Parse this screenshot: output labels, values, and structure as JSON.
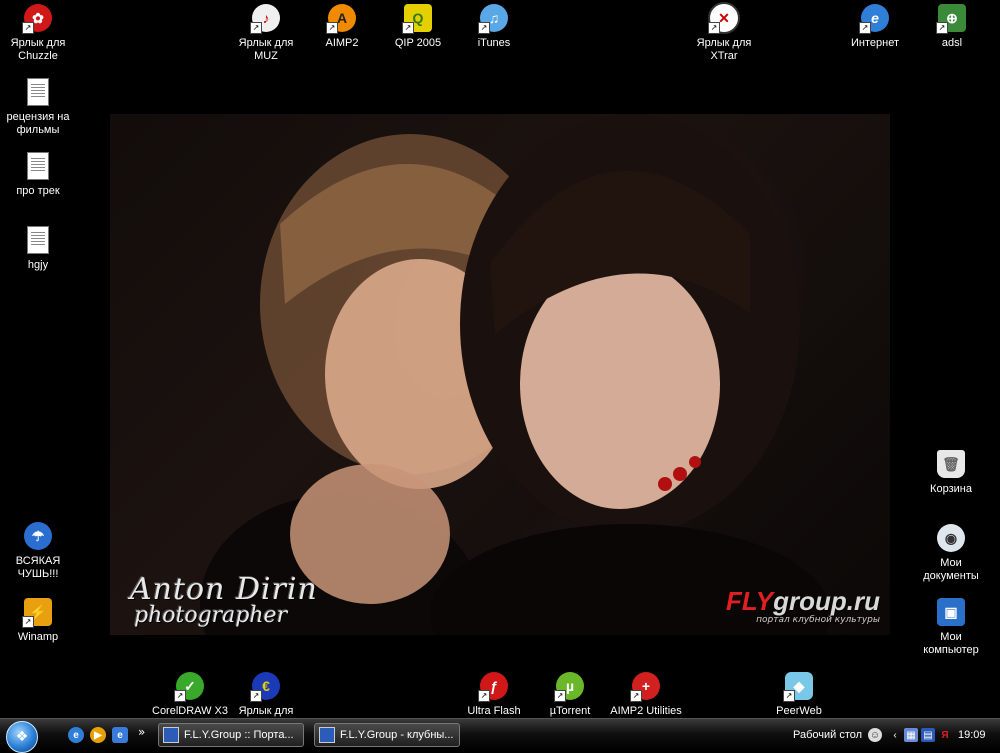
{
  "desktop": {
    "wallpaper": {
      "watermark_left_line1": "Anton Dirin",
      "watermark_left_line2": "photographer",
      "watermark_right_brand_accent": "FLY",
      "watermark_right_brand_rest": "group.ru",
      "watermark_right_tagline": "портал клубной культуры"
    },
    "icons": {
      "chuzzle": "Ярлык для Chuzzle",
      "muz": "Ярлык для MUZ",
      "aimp2": "AIMP2",
      "qip": "QIP 2005",
      "itunes": "iTunes",
      "xtrar": "Ярлык для XTrar",
      "internet": "Интернет",
      "adsl": "adsl",
      "recenzia": "рецензия на фильмы",
      "pro_trek": "про трек",
      "hgjy": "hgjy",
      "vsyakaya": "ВСЯКАЯ ЧУШЬ!!!",
      "winamp": "Winamp",
      "korzina": "Корзина",
      "moi_dokumenty": "Мои документы",
      "moi_kompyuter": "Мои компьютер",
      "coreldraw": "CorelDRAW X3",
      "yarlyk_dlya": "Ярлык для",
      "ultraflash": "Ultra Flash",
      "utorrent": "µTorrent",
      "aimp2_utilities": "AIMP2 Utilities",
      "peerweb": "PeerWeb"
    }
  },
  "taskbar": {
    "tasks": [
      "F.L.Y.Group :: Порта...",
      "F.L.Y.Group - клубны..."
    ],
    "tray_label": "Рабочий стол",
    "clock": "19:09"
  },
  "colors": {
    "desktop_bg": "#000000",
    "taskbar_bg": "#101010",
    "watermark_red": "#e02020"
  }
}
